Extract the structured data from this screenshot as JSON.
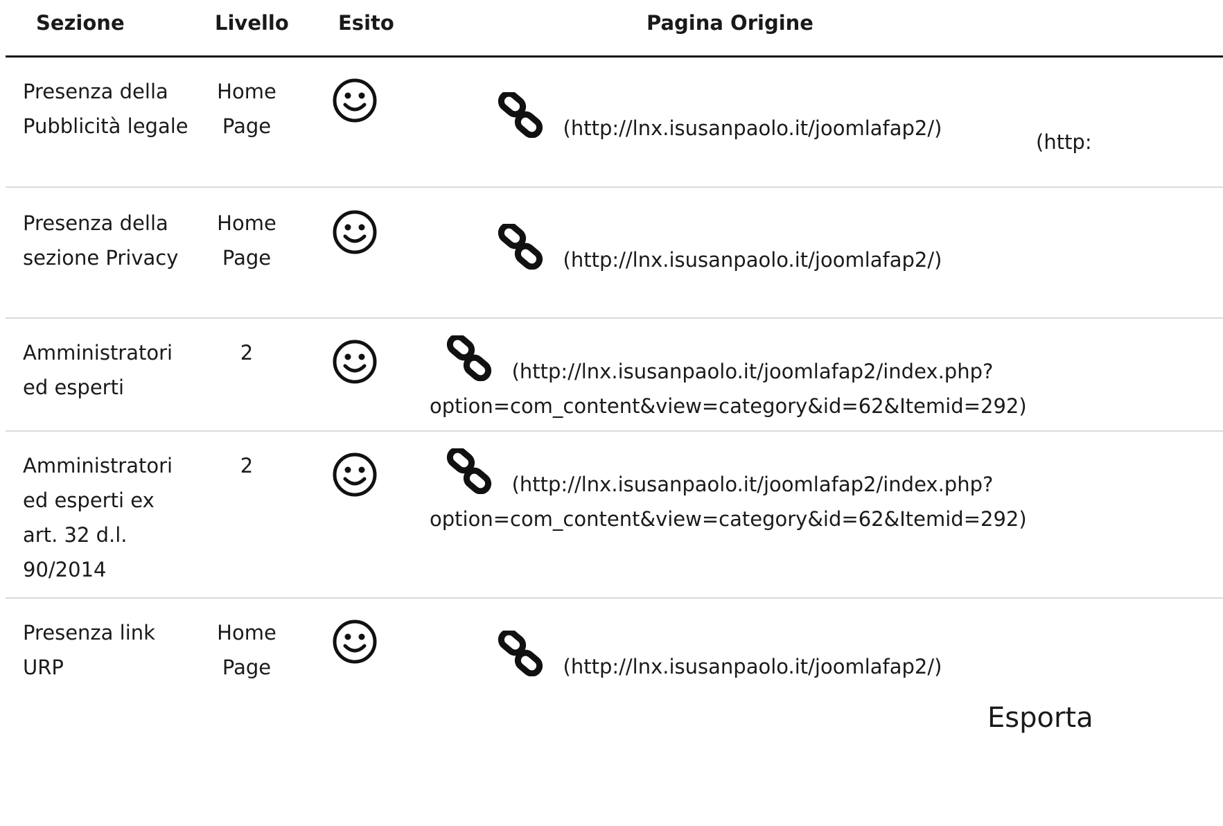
{
  "table": {
    "headers": {
      "sezione": "Sezione",
      "livello": "Livello",
      "esito": "Esito",
      "pagina": "Pagina Origine"
    },
    "rows": [
      {
        "sezione": "Presenza della Pubblicità legale",
        "livello": "Home Page",
        "esito_icon": "smiley-icon",
        "link_icon": "chain-link-icon",
        "url": "(http://lnx.isusanpaolo.it/joomlafap2/)"
      },
      {
        "sezione": "Presenza della sezione Privacy",
        "livello": "Home Page",
        "esito_icon": "smiley-icon",
        "link_icon": "chain-link-icon",
        "url": "(http://lnx.isusanpaolo.it/joomlafap2/)"
      },
      {
        "sezione": "Amministratori ed esperti",
        "livello": "2",
        "esito_icon": "smiley-icon",
        "link_icon": "chain-link-icon",
        "url": "(http://lnx.isusanpaolo.it/joomlafap2/index.php?option=com_content&view=category&id=62&Itemid=292)"
      },
      {
        "sezione": "Amministratori ed esperti ex art. 32 d.l. 90/2014",
        "livello": "2",
        "esito_icon": "smiley-icon",
        "link_icon": "chain-link-icon",
        "url": "(http://lnx.isusanpaolo.it/joomlafap2/index.php?option=com_content&view=category&id=62&Itemid=292)"
      },
      {
        "sezione": "Presenza link URP",
        "livello": "Home Page",
        "esito_icon": "smiley-icon",
        "link_icon": "chain-link-icon",
        "url": "(http://lnx.isusanpaolo.it/joomlafap2/)"
      }
    ],
    "overflow_text": "(http:"
  },
  "footer": {
    "export_label": "Esporta"
  }
}
